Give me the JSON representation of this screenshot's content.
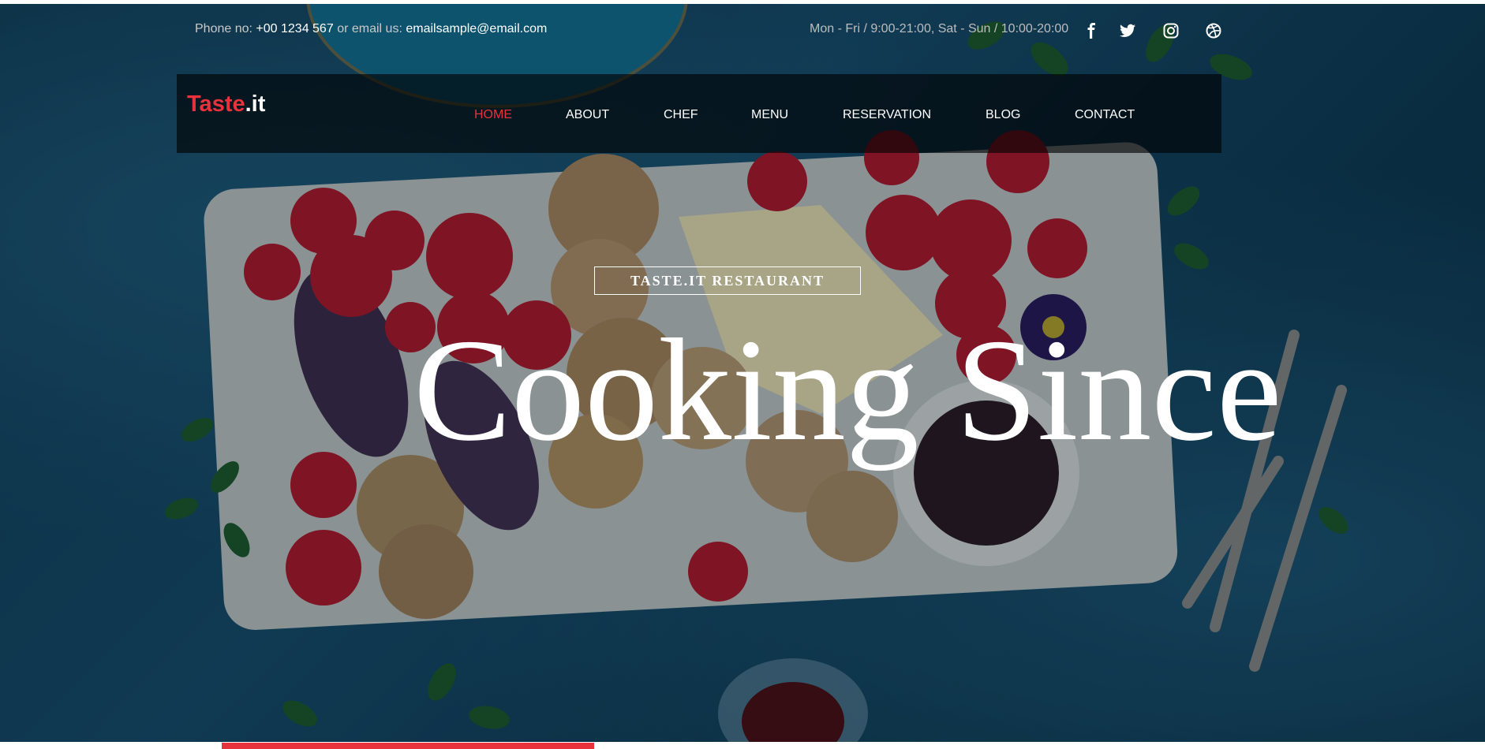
{
  "topbar": {
    "phone_label": "Phone no:",
    "phone_value": "+00 1234 567",
    "or_text": "or",
    "email_label": "email us:",
    "email_value": "emailsample@email.com",
    "hours": "Mon - Fri / 9:00-21:00, Sat - Sun / 10:00-20:00",
    "social_icons": [
      "facebook-icon",
      "twitter-icon",
      "instagram-icon",
      "dribbble-icon"
    ]
  },
  "brand": {
    "name": "Taste",
    "suffix": ".it",
    "accent_color": "#e8323c"
  },
  "nav": {
    "items": [
      {
        "label": "HOME",
        "active": true
      },
      {
        "label": "ABOUT"
      },
      {
        "label": "CHEF"
      },
      {
        "label": "MENU"
      },
      {
        "label": "RESERVATION"
      },
      {
        "label": "BLOG"
      },
      {
        "label": "CONTACT"
      }
    ]
  },
  "hero": {
    "tagline": "TASTE.IT RESTAURANT",
    "headline": "Cooking Since"
  }
}
